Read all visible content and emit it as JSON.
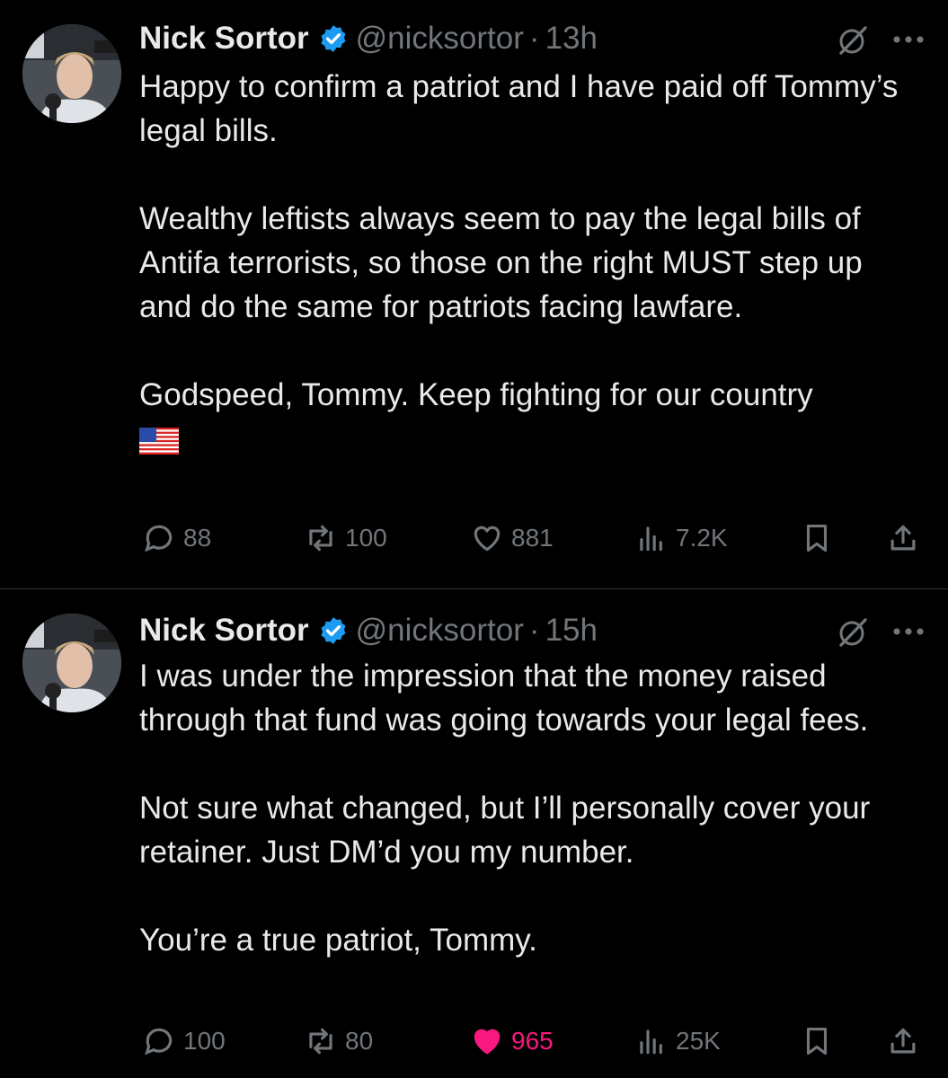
{
  "tweets": [
    {
      "author_name": "Nick Sortor",
      "handle": "@nicksortor",
      "separator": "·",
      "time": "13h",
      "paragraphs": [
        "Happy to confirm a patriot and I have paid off Tommy’s legal bills.",
        "Wealthy leftists always seem to pay the legal bills of Antifa terrorists, so those on the right MUST step up and do the same for patriots facing lawfare.",
        "Godspeed, Tommy. Keep fighting for our country"
      ],
      "flag_emoji": "us-flag-emoji",
      "stats": {
        "replies": "88",
        "reposts": "100",
        "likes": "881",
        "views": "7.2K"
      },
      "liked": false
    },
    {
      "author_name": "Nick Sortor",
      "handle": "@nicksortor",
      "separator": "·",
      "time": "15h",
      "paragraphs": [
        "I was under the impression that the money raised through that fund was going towards your legal fees.",
        "Not sure what changed, but I’ll personally cover your retainer. Just DM’d you my number.",
        "You’re a true patriot, Tommy."
      ],
      "stats": {
        "replies": "100",
        "reposts": "80",
        "likes": "965",
        "views": "25K"
      },
      "liked": true
    }
  ],
  "colors": {
    "background": "#000000",
    "text": "#e7e9ea",
    "muted": "#71767b",
    "verified": "#1d9bf0",
    "like_active": "#f91880",
    "divider": "#2f3336"
  },
  "icons": [
    "verified-badge-icon",
    "grok-icon",
    "more-icon",
    "reply-icon",
    "repost-icon",
    "like-icon",
    "views-icon",
    "bookmark-icon",
    "share-icon"
  ]
}
